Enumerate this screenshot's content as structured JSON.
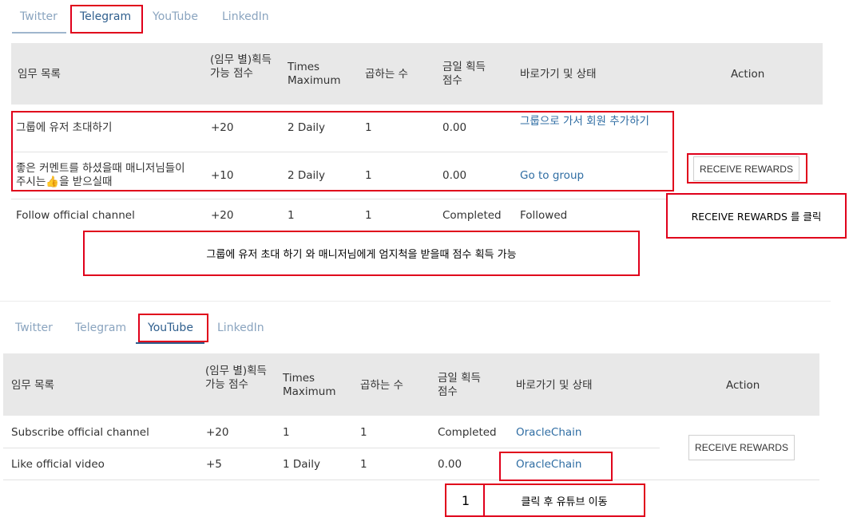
{
  "panel1": {
    "tabs": [
      "Twitter",
      "Telegram",
      "YouTube",
      "LinkedIn"
    ],
    "active_tab": "Telegram",
    "headers": {
      "task": "임무 목록",
      "points": "(임무 별)획득 가능 점수",
      "times_max": "Times Maximum",
      "multiplier": "곱하는 수",
      "today_points": "금일 획득 점수",
      "shortcut_status": "바로가기 및 상태",
      "action": "Action"
    },
    "rows": [
      {
        "task": "그룹에 유저 초대하기",
        "points": "+20",
        "times_max": "2 Daily",
        "multiplier": "1",
        "today_points": "0.00",
        "shortcut_status": "그룹으로 가서 회원 추가하기"
      },
      {
        "task": "좋은 커멘트를 하셨을때 매니저님들이 주시는👍을 받으실때",
        "points": "+10",
        "times_max": "2 Daily",
        "multiplier": "1",
        "today_points": "0.00",
        "shortcut_status": "Go to group"
      },
      {
        "task": "Follow official channel",
        "points": "+20",
        "times_max": "1",
        "multiplier": "1",
        "today_points": "Completed",
        "shortcut_status": "Followed"
      }
    ],
    "action_button": "RECEIVE REWARDS",
    "annotation_click": "RECEIVE REWARDS 를 클릭",
    "annotation_points": "그룹에 유저 초대 하기 와 매니저님에게 엄지척을 받을때 점수 획득 가능"
  },
  "panel2": {
    "tabs": [
      "Twitter",
      "Telegram",
      "YouTube",
      "LinkedIn"
    ],
    "active_tab": "YouTube",
    "headers": {
      "task": "임무 목록",
      "points": "(임무 별)획득 가능 점수",
      "times_max": "Times Maximum",
      "multiplier": "곱하는 수",
      "today_points": "금일 획득 점수",
      "shortcut_status": "바로가기 및 상태",
      "action": "Action"
    },
    "rows": [
      {
        "task": "Subscribe official channel",
        "points": "+20",
        "times_max": "1",
        "multiplier": "1",
        "today_points": "Completed",
        "shortcut_status": "OracleChain"
      },
      {
        "task": "Like official video",
        "points": "+5",
        "times_max": "1 Daily",
        "multiplier": "1",
        "today_points": "0.00",
        "shortcut_status": "OracleChain"
      }
    ],
    "action_button": "RECEIVE REWARDS",
    "annotation_number": "1",
    "annotation_text": "클릭 후 유튜브 이동"
  },
  "colors": {
    "accent": "#2f5f8e",
    "link": "#2f6da3",
    "annotation_red": "#e0001b",
    "header_bg": "#e8e8e8"
  }
}
